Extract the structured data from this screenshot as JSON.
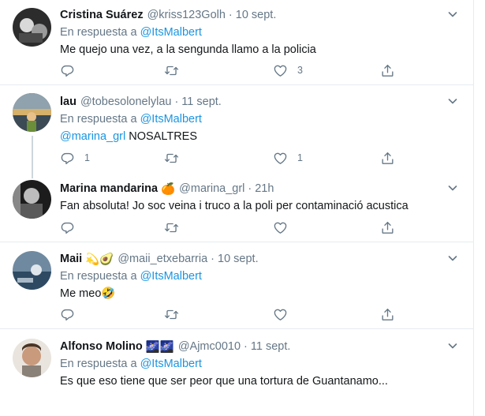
{
  "tweets": [
    {
      "name": "Cristina Suárez",
      "handle": "@kriss123Golh",
      "time": "10 sept.",
      "reply_prefix": "En respuesta a",
      "reply_to": "@ItsMalbert",
      "text": "Me quejo una vez, a la sengunda llamo a la policia",
      "counts": {
        "reply": "",
        "retweet": "",
        "like": "3"
      }
    },
    {
      "name": "lau",
      "handle": "@tobesolonelylau",
      "time": "11 sept.",
      "reply_prefix": "En respuesta a",
      "reply_to": "@ItsMalbert",
      "text_mention": "@marina_grl",
      "text": "NOSALTRES",
      "counts": {
        "reply": "1",
        "retweet": "",
        "like": "1"
      }
    },
    {
      "name": "Marina mandarina",
      "name_emoji": "🍊",
      "handle": "@marina_grl",
      "time": "21h",
      "text": "Fan absoluta! Jo soc veina i truco a la poli per contaminació acustica",
      "counts": {
        "reply": "",
        "retweet": "",
        "like": ""
      }
    },
    {
      "name": "Maii",
      "name_emoji": "💫🥑",
      "handle": "@maii_etxebarria",
      "time": "10 sept.",
      "reply_prefix": "En respuesta a",
      "reply_to": "@ItsMalbert",
      "text": "Me meo🤣",
      "counts": {
        "reply": "",
        "retweet": "",
        "like": ""
      }
    },
    {
      "name": "Alfonso Molino",
      "name_emoji": "🌌🌌",
      "handle": "@Ajmc0010",
      "time": "11 sept.",
      "reply_prefix": "En respuesta a",
      "reply_to": "@ItsMalbert",
      "text": "Es que eso tiene que ser peor que una tortura de Guantanamo..."
    }
  ],
  "separator": "·",
  "icons": [
    "reply-icon",
    "retweet-icon",
    "like-icon",
    "share-icon",
    "chevron-down-icon"
  ],
  "colors": {
    "mention": "#1b95e0",
    "muted": "#657786",
    "divider": "#e6ecf0",
    "thread_line": "#ccd6dd"
  }
}
